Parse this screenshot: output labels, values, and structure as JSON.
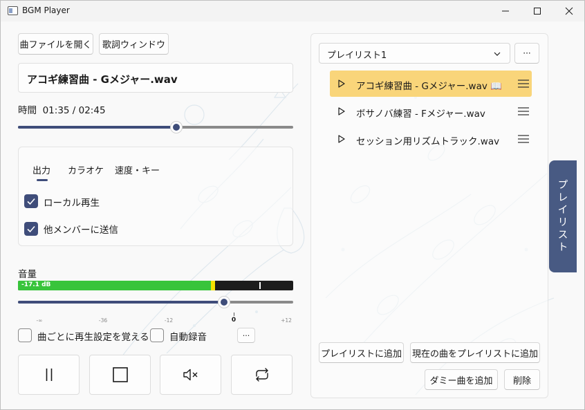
{
  "window": {
    "title": "BGM Player"
  },
  "toolbar": {
    "open_file": "曲ファイルを開く",
    "lyrics_window": "歌詞ウィンドウ"
  },
  "now_playing": {
    "title": "アコギ練習曲 - Gメジャー.wav",
    "time_label": "時間",
    "time_value": "01:35 / 02:45",
    "progress_fraction": 0.576
  },
  "tabs": {
    "items": [
      "出力",
      "カラオケ",
      "速度・キー"
    ],
    "selected": "出力"
  },
  "output": {
    "local_play": {
      "label": "ローカル再生",
      "checked": true
    },
    "send_to_members": {
      "label": "他メンバーに送信",
      "checked": true
    }
  },
  "volume": {
    "label": "音量",
    "meter_text": "-17.1 dB",
    "slider_db": 0,
    "scale": [
      "-∞",
      "-36",
      "-12",
      "0",
      "+12"
    ]
  },
  "options": {
    "remember_settings": {
      "label": "曲ごとに再生設定を覚える",
      "checked": false
    },
    "auto_record": {
      "label": "自動録音",
      "checked": false
    },
    "more": "···"
  },
  "transport": {
    "icons": [
      "pause-icon",
      "stop-icon",
      "mute-icon",
      "repeat-icon"
    ]
  },
  "playlist": {
    "selected": "プレイリスト1",
    "more": "···",
    "items": [
      {
        "name": "アコギ練習曲 - Gメジャー.wav 📖",
        "active": true
      },
      {
        "name": "ボサノバ練習 - Fメジャー.wav",
        "active": false
      },
      {
        "name": "セッション用リズムトラック.wav",
        "active": false
      }
    ],
    "add_to_playlist": "プレイリストに追加",
    "add_current": "現在の曲をプレイリストに追加",
    "add_dummy": "ダミー曲を追加",
    "delete": "削除"
  },
  "side_tab": {
    "label": "プレイリスト"
  },
  "colors": {
    "accent": "#3f4d7a",
    "active_item": "#f9d57a",
    "side_tab": "#485a83",
    "meter_green": "#38c43b"
  }
}
